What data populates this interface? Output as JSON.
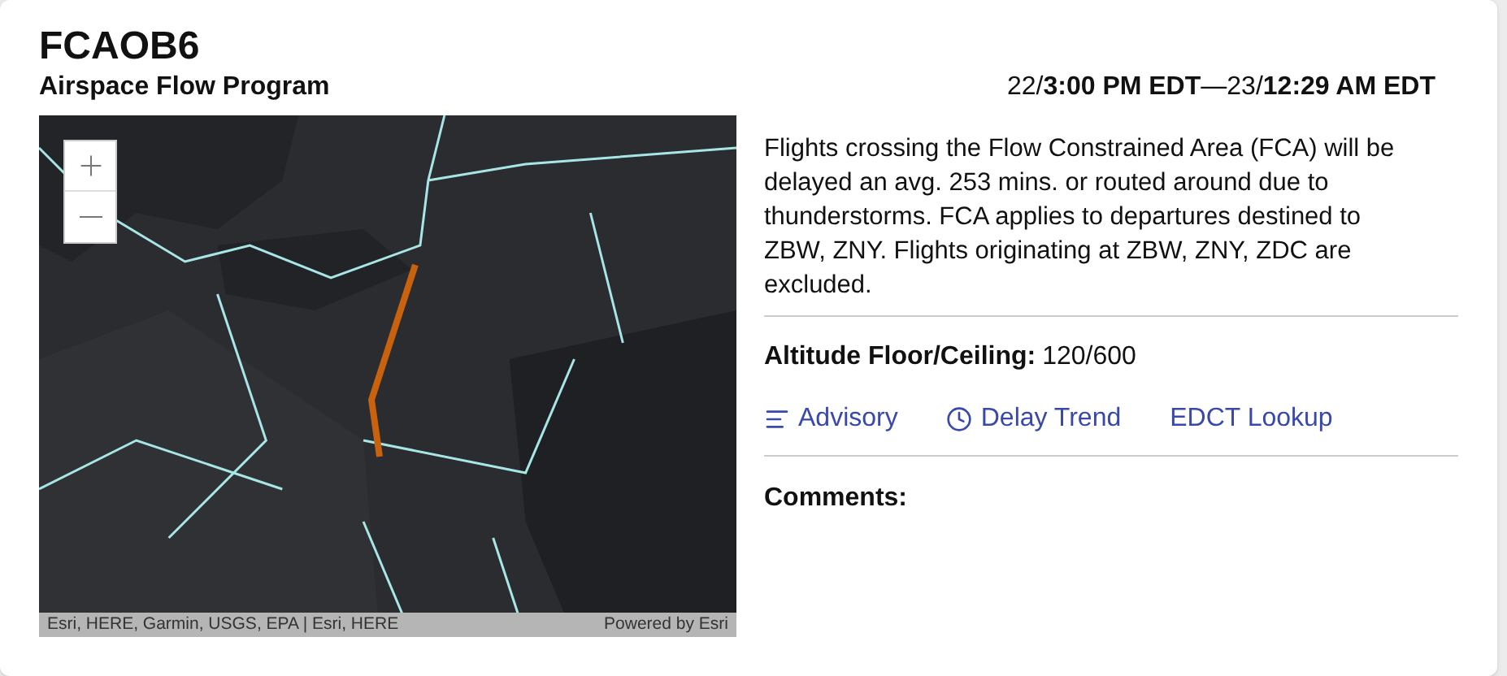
{
  "header": {
    "title": "FCAOB6",
    "subtitle": "Airspace Flow Program",
    "time_range": "22/**3:00 PM EDT**—23/**12:29 AM EDT**"
  },
  "map": {
    "kind": "picture",
    "attribution": "Esri, HERE, Garmin, USGS, EPA | Esri, HERE",
    "powered_by": "Powered by Esri"
  },
  "description": "Flights crossing the Flow Constrained Area (FCA) will be delayed an avg. 253 mins. or routed around due to thunderstorms. FCA applies to departures destined to ZBW, ZNY. Flights originating at ZBW, ZNY, ZDC are excluded.",
  "altitude": {
    "label": "Altitude Floor/Ceiling:",
    "value": "120/600"
  },
  "links": [
    {
      "label": "Advisory",
      "kind": "lines"
    },
    {
      "label": "Delay Trend",
      "kind": "clock"
    },
    {
      "label": "EDCT Lookup",
      "kind": "plain"
    }
  ],
  "comments": {
    "label": "Comments:"
  }
}
